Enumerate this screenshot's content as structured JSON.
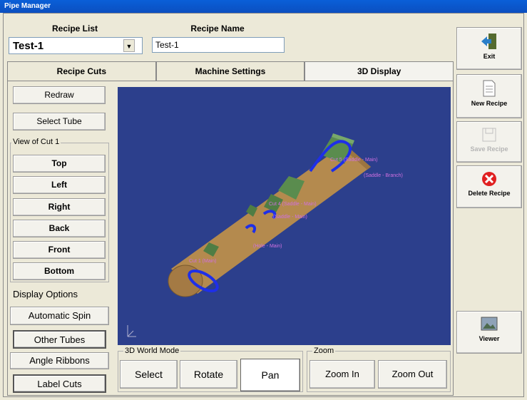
{
  "window": {
    "title": "Pipe Manager"
  },
  "recipe_list": {
    "label": "Recipe List",
    "value": "Test-1"
  },
  "recipe_name": {
    "label": "Recipe Name",
    "value": "Test-1"
  },
  "tabs": [
    {
      "label": "Recipe Cuts"
    },
    {
      "label": "Machine Settings"
    },
    {
      "label": "3D Display"
    }
  ],
  "left_buttons": {
    "redraw": "Redraw",
    "select_tube": "Select Tube"
  },
  "view_group": {
    "label": "View of Cut 1",
    "buttons": [
      "Top",
      "Left",
      "Right",
      "Back",
      "Front",
      "Bottom"
    ]
  },
  "display_options": {
    "label": "Display Options",
    "buttons": [
      "Automatic Spin",
      "Other Tubes",
      "Angle Ribbons",
      "Label Cuts"
    ]
  },
  "world_mode": {
    "label": "3D World Mode",
    "buttons": [
      "Select",
      "Rotate",
      "Pan"
    ]
  },
  "zoom": {
    "label": "Zoom",
    "buttons": [
      "Zoom In",
      "Zoom Out"
    ]
  },
  "viewport_labels": [
    "Cut 5 (Saddle - Main)",
    "(Saddle - Branch)",
    "Cut 4 (Saddle - Main)",
    "(Saddle - Main)",
    "(Hole - Main)",
    "Cut 1 (Main)"
  ],
  "sidebar": {
    "exit": "Exit",
    "new_recipe": "New Recipe",
    "save_recipe": "Save Recipe",
    "delete_recipe": "Delete Recipe",
    "viewer": "Viewer"
  },
  "colors": {
    "viewport_bg": "#2c3f8c",
    "pipe": "#b48a4e",
    "branch": "#5a8c4e",
    "cut_ring": "#1e2fe8",
    "label": "#d070e0"
  }
}
